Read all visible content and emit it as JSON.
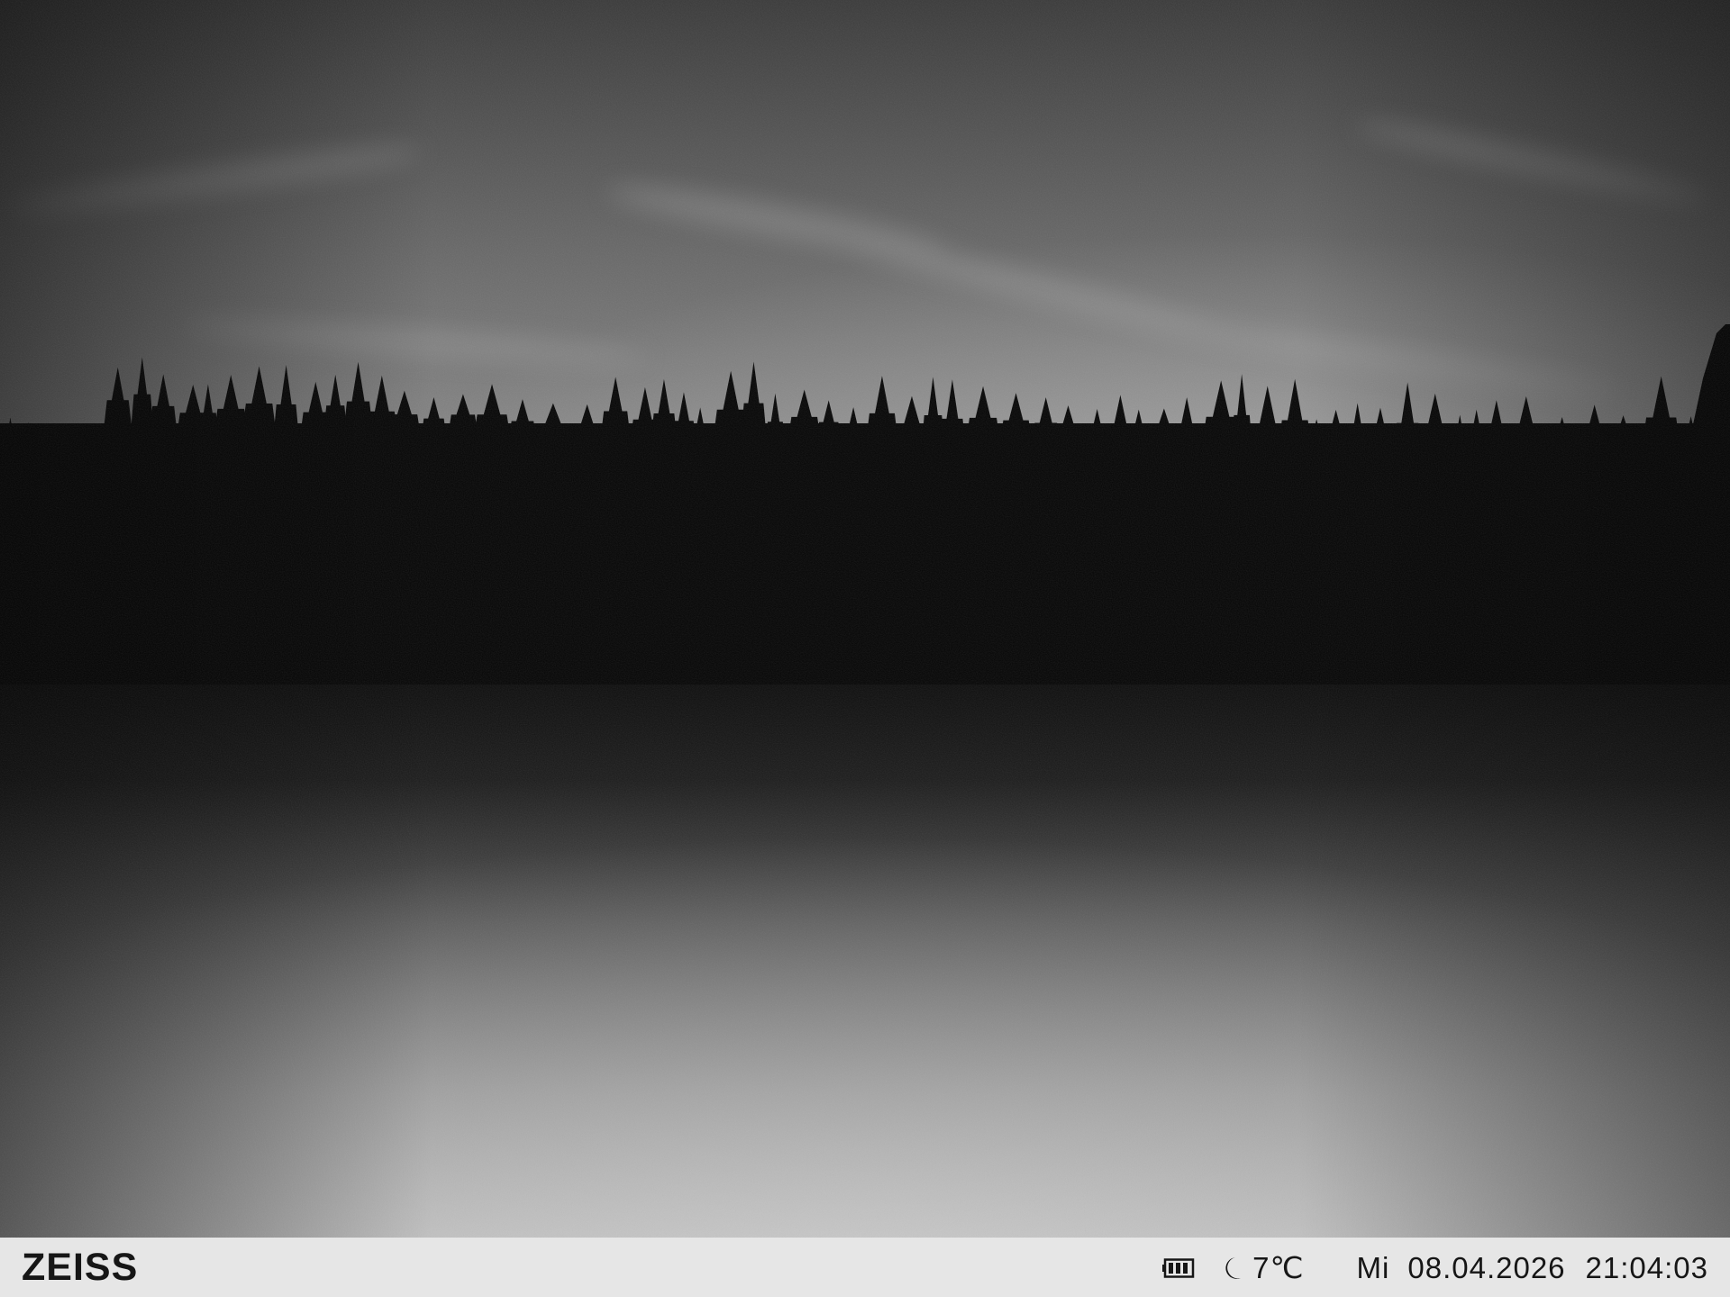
{
  "overlay": {
    "brand": "ZEISS",
    "temperature": "7℃",
    "weekday": "Mi",
    "date": "08.04.2026",
    "time": "21:04:03"
  },
  "icons": {
    "battery": "battery-full-icon",
    "night_mode": "moon-icon"
  },
  "colors": {
    "info_bar_background": "#e6e6e6",
    "info_bar_text": "#161616"
  }
}
